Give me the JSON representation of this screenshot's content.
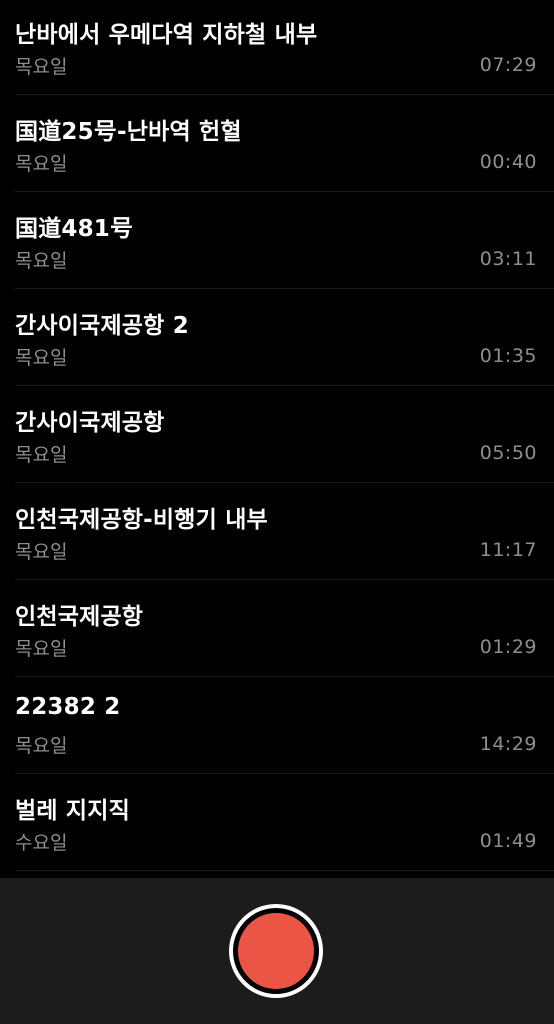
{
  "recordings": [
    {
      "title": "난바에서 우메다역 지하철 내부",
      "day": "목요일",
      "duration": "07:29"
    },
    {
      "title": "国道25号-난바역 헌혈",
      "day": "목요일",
      "duration": "00:40"
    },
    {
      "title": "国道481号",
      "day": "목요일",
      "duration": "03:11"
    },
    {
      "title": "간사이국제공항 2",
      "day": "목요일",
      "duration": "01:35"
    },
    {
      "title": "간사이국제공항",
      "day": "목요일",
      "duration": "05:50"
    },
    {
      "title": "인천국제공항-비행기 내부",
      "day": "목요일",
      "duration": "11:17"
    },
    {
      "title": "인천국제공항",
      "day": "목요일",
      "duration": "01:29"
    },
    {
      "title": "22382 2",
      "day": "목요일",
      "duration": "14:29"
    },
    {
      "title": "벌레 지지직",
      "day": "수요일",
      "duration": "01:49"
    }
  ],
  "record_button": {
    "icon": "record-icon",
    "color": "#eb5545"
  }
}
